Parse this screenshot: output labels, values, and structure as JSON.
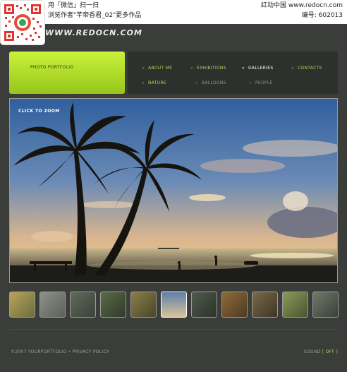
{
  "top": {
    "line1": "用「微信」扫一扫",
    "line2": "浏览作者\"芊帝香君_02\"更多作品",
    "brand": "红动中国 www.redocn.com",
    "code": "编号: 602013"
  },
  "logo": "WWW.REDOCN.COM",
  "section_title": "PHOTO PORTFOLIO",
  "nav": {
    "items": [
      {
        "label": "ABOUT ME"
      },
      {
        "label": "EXHIBITIONS"
      },
      {
        "label": "GALLERIES"
      },
      {
        "label": "CONTACTS"
      },
      {
        "label": "NATURE"
      },
      {
        "label": "BALLOONS"
      },
      {
        "label": "PEOPLE"
      }
    ],
    "active": "GALLERIES",
    "bullet": "»"
  },
  "photo": {
    "zoom_label": "CLICK TO ZOOM"
  },
  "thumbnails": {
    "count": 11,
    "selected_index": 5
  },
  "footer": {
    "copyright": "©2007 YOURPORTFOLIO • PRIVACY POLICY",
    "sound_label": "SOUND",
    "sound_state": "[ OFF ]"
  },
  "colors": {
    "accent": "#b7d14d",
    "background": "#3b3d3a",
    "header_green": "#b3e02c"
  }
}
